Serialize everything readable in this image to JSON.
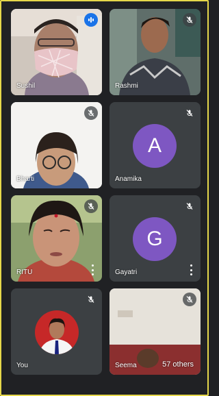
{
  "participants": [
    {
      "name": "Sushil",
      "status": "speaking",
      "icon": "audio-level-icon"
    },
    {
      "name": "Rashmi",
      "status": "muted",
      "icon": "mic-off-icon"
    },
    {
      "name": "Bharti",
      "status": "muted",
      "icon": "mic-off-icon"
    },
    {
      "name": "Anamika",
      "status": "muted",
      "icon": "mic-off-icon",
      "initial": "A",
      "color": "#7e57c2"
    },
    {
      "name": "RITU",
      "status": "muted",
      "icon": "mic-off-icon"
    },
    {
      "name": "Gayatri",
      "status": "muted",
      "icon": "mic-off-icon",
      "initial": "G",
      "color": "#7e57c2"
    },
    {
      "name": "You",
      "status": "muted",
      "icon": "mic-off-icon"
    },
    {
      "name": "Seema",
      "status": "muted",
      "icon": "mic-off-icon"
    }
  ],
  "others_count": "57 others",
  "colors": {
    "background": "#202124",
    "tile": "#3c4043",
    "speaking": "#1a73e8",
    "frame": "#e6d84a"
  }
}
